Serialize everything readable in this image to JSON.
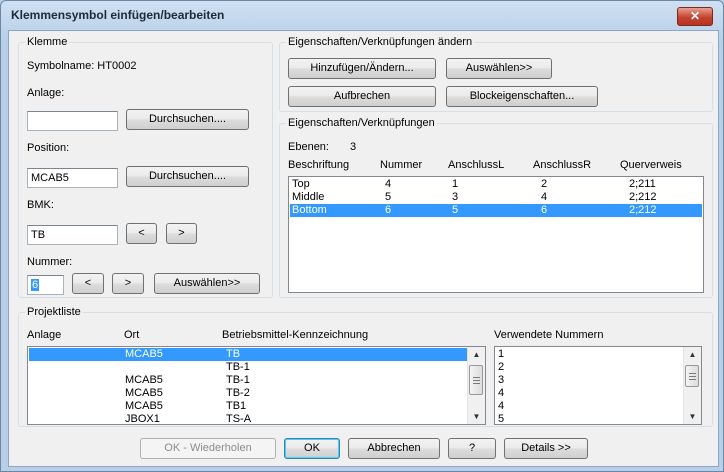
{
  "window": {
    "title": "Klemmensymbol einfügen/bearbeiten",
    "close_label": "✕"
  },
  "klemme": {
    "group_label": "Klemme",
    "symbolname_label": "Symbolname: HT0002",
    "anlage_label": "Anlage:",
    "anlage_value": "",
    "browse1_label": "Durchsuchen....",
    "position_label": "Position:",
    "position_value": "MCAB5",
    "browse2_label": "Durchsuchen....",
    "bmk_label": "BMK:",
    "bmk_value": "TB",
    "bmk_prev": "<",
    "bmk_next": ">",
    "nummer_label": "Nummer:",
    "nummer_value": "6",
    "num_prev": "<",
    "num_next": ">",
    "select_label": "Auswählen>>"
  },
  "eig_aendern": {
    "group_label": "Eigenschaften/Verknüpfungen ändern",
    "add_label": "Hinzufügen/Ändern...",
    "select_label": "Auswählen>>",
    "break_label": "Aufbrechen",
    "block_label": "Blockeigenschaften..."
  },
  "eig": {
    "group_label": "Eigenschaften/Verknüpfungen",
    "ebenen_label": "Ebenen:",
    "ebenen_value": "3",
    "headers": [
      "Beschriftung",
      "Nummer",
      "AnschlussL",
      "AnschlussR",
      "Querverweis"
    ],
    "rows": [
      {
        "label": "Top",
        "nummer": "4",
        "l": "1",
        "r": "2",
        "ref": "2;211",
        "selected": false
      },
      {
        "label": "Middle",
        "nummer": "5",
        "l": "3",
        "r": "4",
        "ref": "2;212",
        "selected": false
      },
      {
        "label": "Bottom",
        "nummer": "6",
        "l": "5",
        "r": "6",
        "ref": "2;212",
        "selected": true
      }
    ]
  },
  "projekt": {
    "group_label": "Projektliste",
    "headers": [
      "Anlage",
      "Ort",
      "Betriebsmittel-Kennzeichnung"
    ],
    "rows": [
      {
        "anlage": "",
        "ort": "MCAB5",
        "bmk": "TB",
        "selected": true
      },
      {
        "anlage": "",
        "ort": "",
        "bmk": "TB-1",
        "selected": false
      },
      {
        "anlage": "",
        "ort": "MCAB5",
        "bmk": "TB-1",
        "selected": false
      },
      {
        "anlage": "",
        "ort": "MCAB5",
        "bmk": "TB-2",
        "selected": false
      },
      {
        "anlage": "",
        "ort": "MCAB5",
        "bmk": "TB1",
        "selected": false
      },
      {
        "anlage": "",
        "ort": "JBOX1",
        "bmk": "TS-A",
        "selected": false
      }
    ],
    "numbers_header": "Verwendete Nummern",
    "numbers": [
      "1",
      "2",
      "3",
      "4",
      "4",
      "5"
    ]
  },
  "footer": {
    "repeat_label": "OK - Wiederholen",
    "ok_label": "OK",
    "cancel_label": "Abbrechen",
    "help_label": "?",
    "details_label": "Details >>"
  },
  "icons": {
    "scroll_up": "▲",
    "scroll_down": "▼"
  }
}
